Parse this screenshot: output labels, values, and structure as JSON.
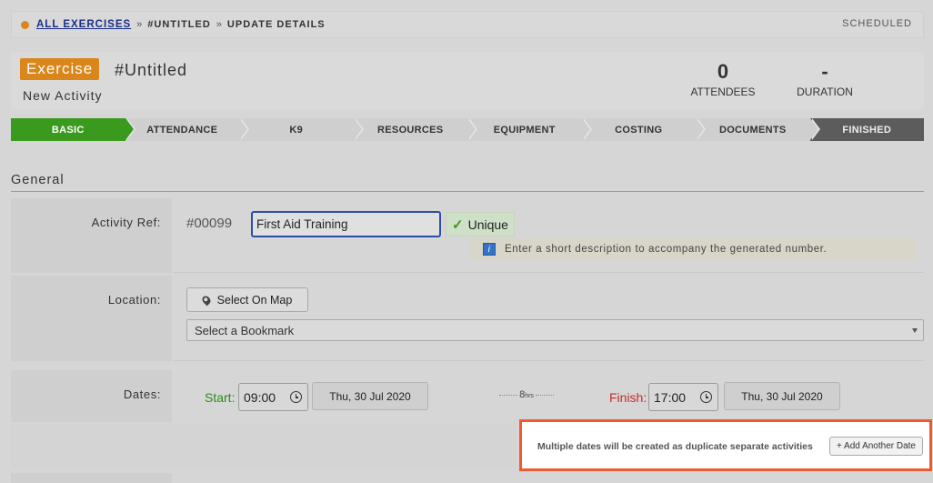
{
  "breadcrumb": {
    "all_exercises": "ALL EXERCISES",
    "sep1": "»",
    "untitled": "#UNTITLED",
    "sep2": "»",
    "update_details": "UPDATE DETAILS",
    "status": "SCHEDULED"
  },
  "header": {
    "tag": "Exercise",
    "title": "#Untitled",
    "subtitle": "New Activity",
    "attendees_value": "0",
    "attendees_label": "ATTENDEES",
    "duration_value": "-",
    "duration_label": "DURATION"
  },
  "steps": [
    "BASIC",
    "ATTENDANCE",
    "K9",
    "RESOURCES",
    "EQUIPMENT",
    "COSTING",
    "DOCUMENTS",
    "FINISHED"
  ],
  "section": {
    "title": "General"
  },
  "activity_ref": {
    "label": "Activity Ref:",
    "number": "#00099",
    "value": "First Aid Training",
    "unique_label": "Unique",
    "hint": "Enter a short description to accompany the generated number."
  },
  "location": {
    "label": "Location:",
    "map_button": "Select On Map",
    "bookmark_placeholder": "Select a Bookmark"
  },
  "dates": {
    "label": "Dates:",
    "start_label": "Start:",
    "start_time": "09:00",
    "start_date": "Thu, 30 Jul 2020",
    "duration_value": "8",
    "duration_unit": "hrs",
    "finish_label": "Finish:",
    "finish_time": "17:00",
    "finish_date": "Thu, 30 Jul 2020",
    "multiple_note": "Multiple dates will be created as duplicate separate activities",
    "add_date_button": "+ Add Another Date"
  },
  "colors": {
    "accent_orange": "#d9861a",
    "active_step_green": "#3a9a1e",
    "start_green": "#2e8c1a",
    "finish_red": "#c42b2b",
    "highlight_border": "#ef5b2f"
  }
}
